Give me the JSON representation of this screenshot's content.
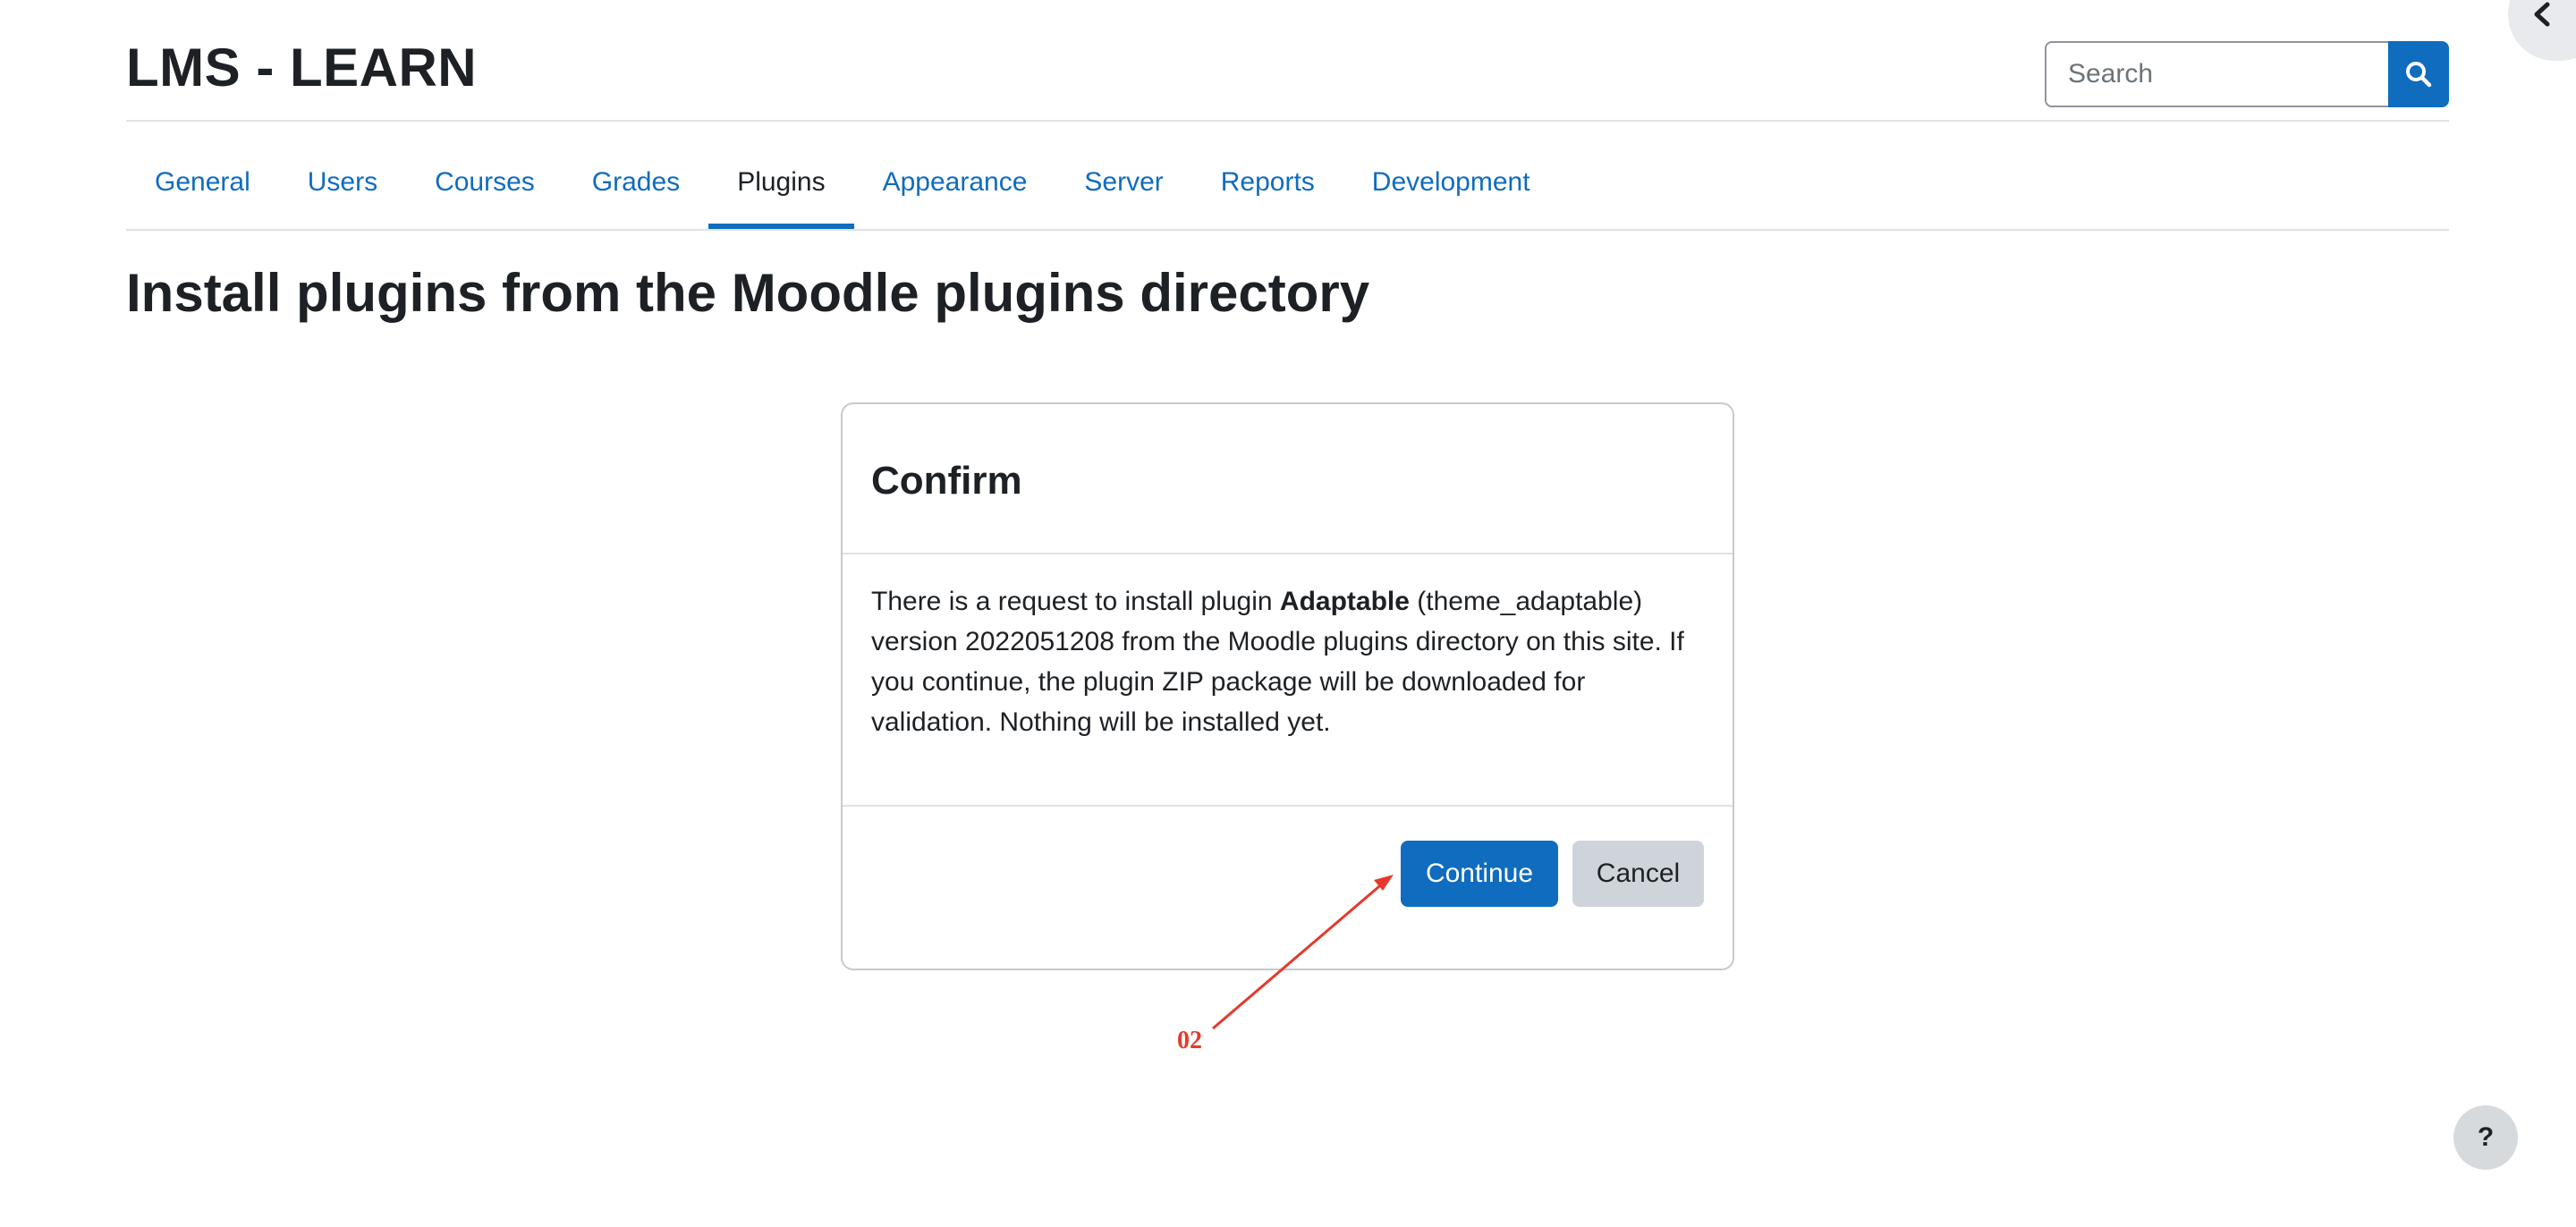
{
  "header": {
    "site_name": "LMS - LEARN",
    "search_placeholder": "Search"
  },
  "nav": {
    "tabs": [
      {
        "label": "General"
      },
      {
        "label": "Users"
      },
      {
        "label": "Courses"
      },
      {
        "label": "Grades"
      },
      {
        "label": "Plugins",
        "active": true
      },
      {
        "label": "Appearance"
      },
      {
        "label": "Server"
      },
      {
        "label": "Reports"
      },
      {
        "label": "Development"
      }
    ]
  },
  "page": {
    "title": "Install plugins from the Moodle plugins directory"
  },
  "modal": {
    "title": "Confirm",
    "body_prefix": "There is a request to install plugin ",
    "plugin_name": "Adaptable",
    "body_suffix": " (theme_adaptable) version 2022051208 from the Moodle plugins directory on this site. If you continue, the plugin ZIP package will be downloaded for validation. Nothing will be installed yet.",
    "continue_label": "Continue",
    "cancel_label": "Cancel"
  },
  "annotation": {
    "label": "02",
    "color": "#e53a2b"
  },
  "help": {
    "label": "?"
  },
  "colors": {
    "primary": "#0f6cbf",
    "secondary_button": "#ced4da",
    "text": "#1d2125"
  },
  "icons": {
    "search": "search-icon",
    "drawer": "chevron-left-icon",
    "help": "question-icon"
  }
}
